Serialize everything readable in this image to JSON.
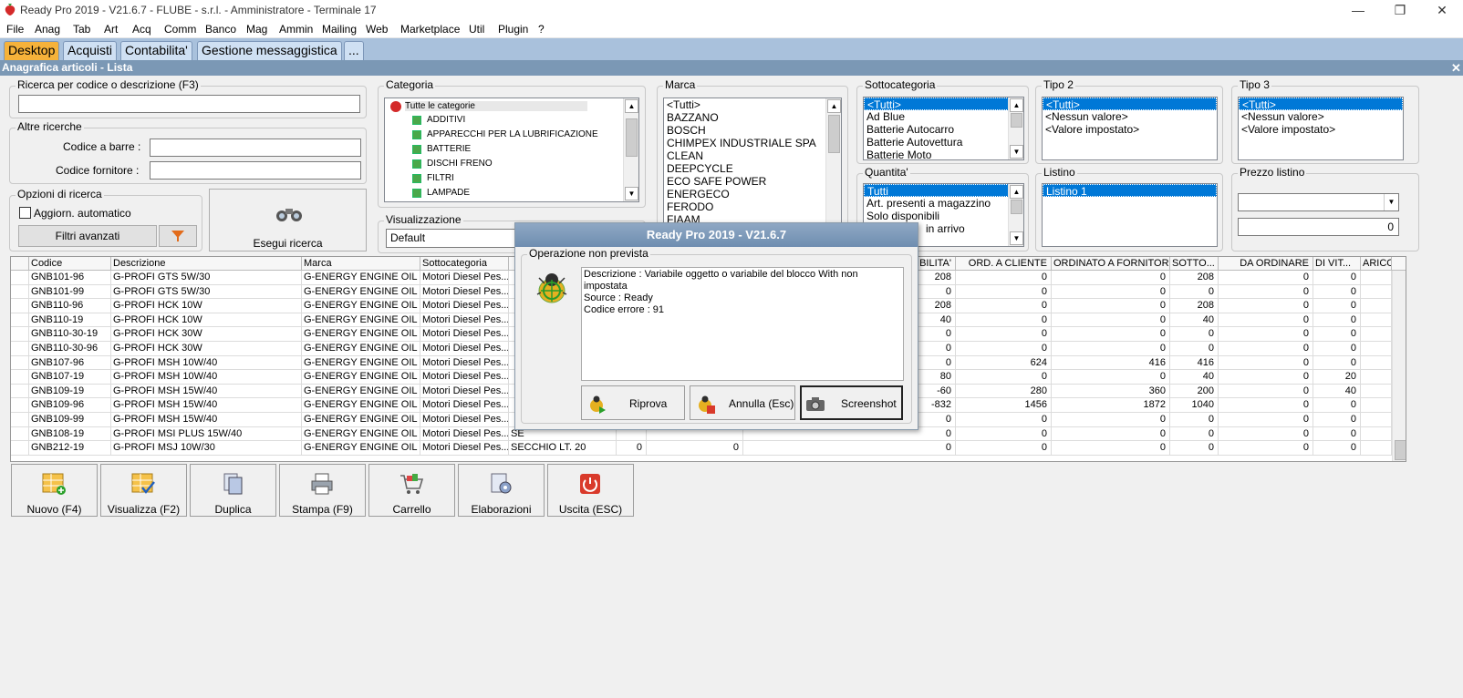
{
  "window": {
    "title": "Ready Pro 2019 - V21.6.7 - FLUBE - s.r.l. - Amministratore - Terminale 17"
  },
  "menu": [
    "File",
    "Anag",
    "Tab",
    "Art",
    "Acq",
    "Comm",
    "Banco",
    "Mag",
    "Ammin",
    "Mailing",
    "Web",
    "Marketplace",
    "Util",
    "Plugin",
    "?"
  ],
  "tabs": [
    "Desktop",
    "Acquisti",
    "Contabilita'",
    "Gestione messaggistica",
    "..."
  ],
  "form": {
    "caption": "Anagrafica articoli  - Lista"
  },
  "search": {
    "title": "Ricerca per codice o descrizione (F3)",
    "value": "",
    "altre_title": "Altre ricerche",
    "barcode_label": "Codice a barre :",
    "supplier_label": "Codice fornitore :",
    "options_title": "Opzioni di ricerca",
    "auto_update_label": "Aggiorn. automatico",
    "advanced_filters_label": "Filtri avanzati",
    "run_label": "Esegui ricerca"
  },
  "categoria": {
    "title": "Categoria",
    "items": [
      "Tutte le categorie",
      "ADDITIVI",
      "APPARECCHI PER LA LUBRIFICAZIONE",
      "BATTERIE",
      "DISCHI FRENO",
      "FILTRI",
      "LAMPADE"
    ]
  },
  "visualizzazione": {
    "title": "Visualizzazione",
    "value": "Default"
  },
  "marca": {
    "title": "Marca",
    "items": [
      "<Tutti>",
      "BAZZANO",
      "BOSCH",
      "CHIMPEX INDUSTRIALE SPA",
      "CLEAN",
      "DEEPCYCLE",
      "ECO SAFE POWER",
      "ENERGECO",
      "FERODO",
      "FIAAM"
    ]
  },
  "sottocategoria": {
    "title": "Sottocategoria",
    "items": [
      "<Tutti>",
      "Ad Blue",
      "Batterie Autocarro",
      "Batterie Autovettura",
      "Batterie Moto"
    ]
  },
  "tipo2": {
    "title": "Tipo 2",
    "items": [
      "<Tutti>",
      "<Nessun valore>",
      "<Valore impostato>"
    ]
  },
  "tipo3": {
    "title": "Tipo 3",
    "items": [
      "<Tutti>",
      "<Nessun valore>",
      "<Valore impostato>"
    ]
  },
  "quantita": {
    "title": "Quantita'",
    "items": [
      "Tutti",
      "Art. presenti a magazzino",
      "Solo disponibili",
      "in arrivo"
    ]
  },
  "listino": {
    "title": "Listino",
    "items": [
      "Listino 1"
    ]
  },
  "prezzo": {
    "title": "Prezzo listino",
    "value": "0"
  },
  "grid": {
    "headers": [
      "Codice",
      "Descrizione",
      "Marca",
      "Sottocategoria",
      "",
      "",
      "",
      "IBILITA'",
      "ORD. A CLIENTE",
      "ORDINATO A FORNITORE",
      "SOTTO...",
      "DA ORDINARE",
      "DI VIT...",
      "ARICO"
    ],
    "rows": [
      [
        "GNB101-96",
        "G-PROFI GTS 5W/30",
        "G-ENERGY ENGINE OIL",
        "Motori Diesel Pes...",
        "",
        "",
        "",
        "208",
        "0",
        "0",
        "208",
        "0",
        "0"
      ],
      [
        "GNB101-99",
        "G-PROFI GTS 5W/30",
        "G-ENERGY ENGINE OIL",
        "Motori Diesel Pes...",
        "",
        "",
        "",
        "0",
        "0",
        "0",
        "0",
        "0",
        "0"
      ],
      [
        "GNB110-96",
        "G-PROFI HCK 10W",
        "G-ENERGY ENGINE OIL",
        "Motori Diesel Pes...",
        "",
        "",
        "",
        "208",
        "0",
        "0",
        "208",
        "0",
        "0"
      ],
      [
        "GNB110-19",
        "G-PROFI HCK 10W",
        "G-ENERGY ENGINE OIL",
        "Motori Diesel Pes...",
        "",
        "",
        "",
        "40",
        "0",
        "0",
        "40",
        "0",
        "0"
      ],
      [
        "GNB110-30-19",
        "G-PROFI HCK 30W",
        "G-ENERGY ENGINE OIL",
        "Motori Diesel Pes...",
        "",
        "",
        "",
        "0",
        "0",
        "0",
        "0",
        "0",
        "0"
      ],
      [
        "GNB110-30-96",
        "G-PROFI HCK 30W",
        "G-ENERGY ENGINE OIL",
        "Motori Diesel Pes...",
        "",
        "",
        "",
        "0",
        "0",
        "0",
        "0",
        "0",
        "0"
      ],
      [
        "GNB107-96",
        "G-PROFI MSH 10W/40",
        "G-ENERGY ENGINE OIL",
        "Motori Diesel Pes...",
        "",
        "",
        "",
        "0",
        "624",
        "416",
        "416",
        "0",
        "0"
      ],
      [
        "GNB107-19",
        "G-PROFI MSH 10W/40",
        "G-ENERGY ENGINE OIL",
        "Motori Diesel Pes...",
        "",
        "",
        "",
        "80",
        "0",
        "0",
        "40",
        "0",
        "20"
      ],
      [
        "GNB109-19",
        "G-PROFI MSH 15W/40",
        "G-ENERGY ENGINE OIL",
        "Motori Diesel Pes...",
        "",
        "",
        "",
        "-60",
        "280",
        "360",
        "200",
        "0",
        "40"
      ],
      [
        "GNB109-96",
        "G-PROFI MSH 15W/40",
        "G-ENERGY ENGINE OIL",
        "Motori Diesel Pes...",
        "",
        "",
        "",
        "-832",
        "1456",
        "1872",
        "1040",
        "0",
        "0"
      ],
      [
        "GNB109-99",
        "G-PROFI MSH 15W/40",
        "G-ENERGY ENGINE OIL",
        "Motori Diesel Pes...",
        "",
        "",
        "",
        "0",
        "0",
        "0",
        "0",
        "0",
        "0"
      ],
      [
        "GNB108-19",
        "G-PROFI MSI PLUS 15W/40",
        "G-ENERGY ENGINE OIL",
        "Motori Diesel Pes...",
        "SE",
        "",
        "",
        "0",
        "0",
        "0",
        "0",
        "0",
        "0"
      ],
      [
        "GNB212-19",
        "G-PROFI MSJ 10W/30",
        "G-ENERGY ENGINE OIL",
        "Motori Diesel Pes...",
        "SECCHIO LT. 20",
        "0",
        "0",
        "0",
        "0",
        "0",
        "0",
        "0",
        "0"
      ]
    ]
  },
  "bottom_buttons": [
    "Nuovo (F4)",
    "Visualizza (F2)",
    "Duplica",
    "Stampa (F9)",
    "Carrello",
    "Elaborazioni",
    "Uscita (ESC)"
  ],
  "dialog": {
    "title": "Ready Pro 2019 - V21.6.7",
    "group": "Operazione non prevista",
    "lines": [
      "Descrizione : Variabile oggetto o variabile del blocco With non impostata",
      "Source : Ready",
      "Codice errore : 91"
    ],
    "retry": "Riprova",
    "cancel": "Annulla (Esc)",
    "screenshot": "Screenshot"
  },
  "colors": {
    "tab_active": "#f6b23a",
    "tab_bar": "#a9c1dc",
    "caption": "#7b98b5",
    "selection": "#0078d7"
  }
}
